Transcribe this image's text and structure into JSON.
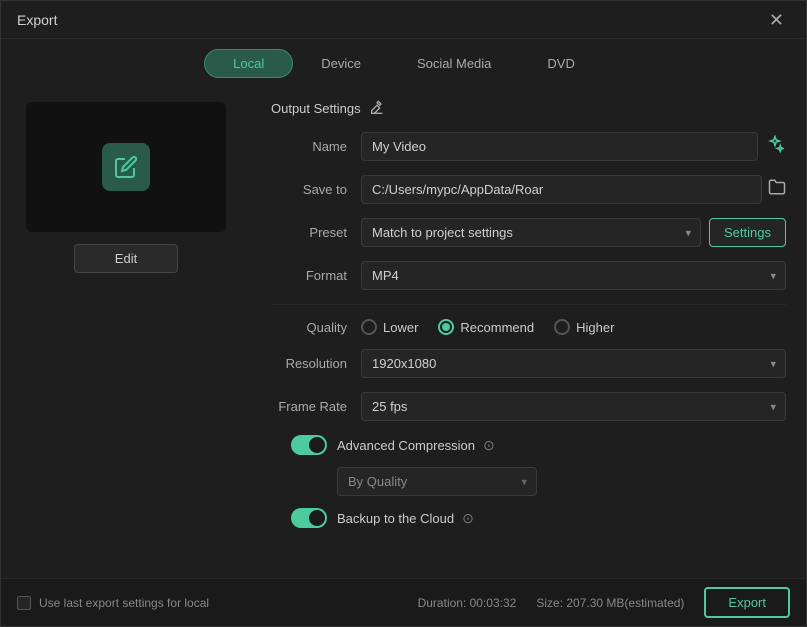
{
  "window": {
    "title": "Export",
    "close_label": "✕"
  },
  "tabs": [
    {
      "id": "local",
      "label": "Local",
      "active": true
    },
    {
      "id": "device",
      "label": "Device",
      "active": false
    },
    {
      "id": "social-media",
      "label": "Social Media",
      "active": false
    },
    {
      "id": "dvd",
      "label": "DVD",
      "active": false
    }
  ],
  "edit_button": "Edit",
  "output_settings": {
    "section_label": "Output Settings",
    "name_label": "Name",
    "name_value": "My Video",
    "save_to_label": "Save to",
    "save_to_value": "C:/Users/mypc/AppData/Roar",
    "preset_label": "Preset",
    "preset_value": "Match to project settings",
    "settings_button": "Settings",
    "format_label": "Format",
    "format_value": "MP4"
  },
  "quality": {
    "label": "Quality",
    "options": [
      {
        "id": "lower",
        "label": "Lower",
        "active": false
      },
      {
        "id": "recommend",
        "label": "Recommend",
        "active": true
      },
      {
        "id": "higher",
        "label": "Higher",
        "active": false
      }
    ]
  },
  "resolution": {
    "label": "Resolution",
    "value": "1920x1080"
  },
  "frame_rate": {
    "label": "Frame Rate",
    "value": "25 fps"
  },
  "advanced_compression": {
    "label": "Advanced Compression",
    "toggle_on": true,
    "by_quality_label": "By Quality"
  },
  "backup_cloud": {
    "label": "Backup to the Cloud",
    "toggle_on": true
  },
  "bottom": {
    "checkbox_label": "Use last export settings for local",
    "duration_label": "Duration: 00:03:32",
    "size_label": "Size: 207.30 MB(estimated)",
    "export_button": "Export"
  }
}
